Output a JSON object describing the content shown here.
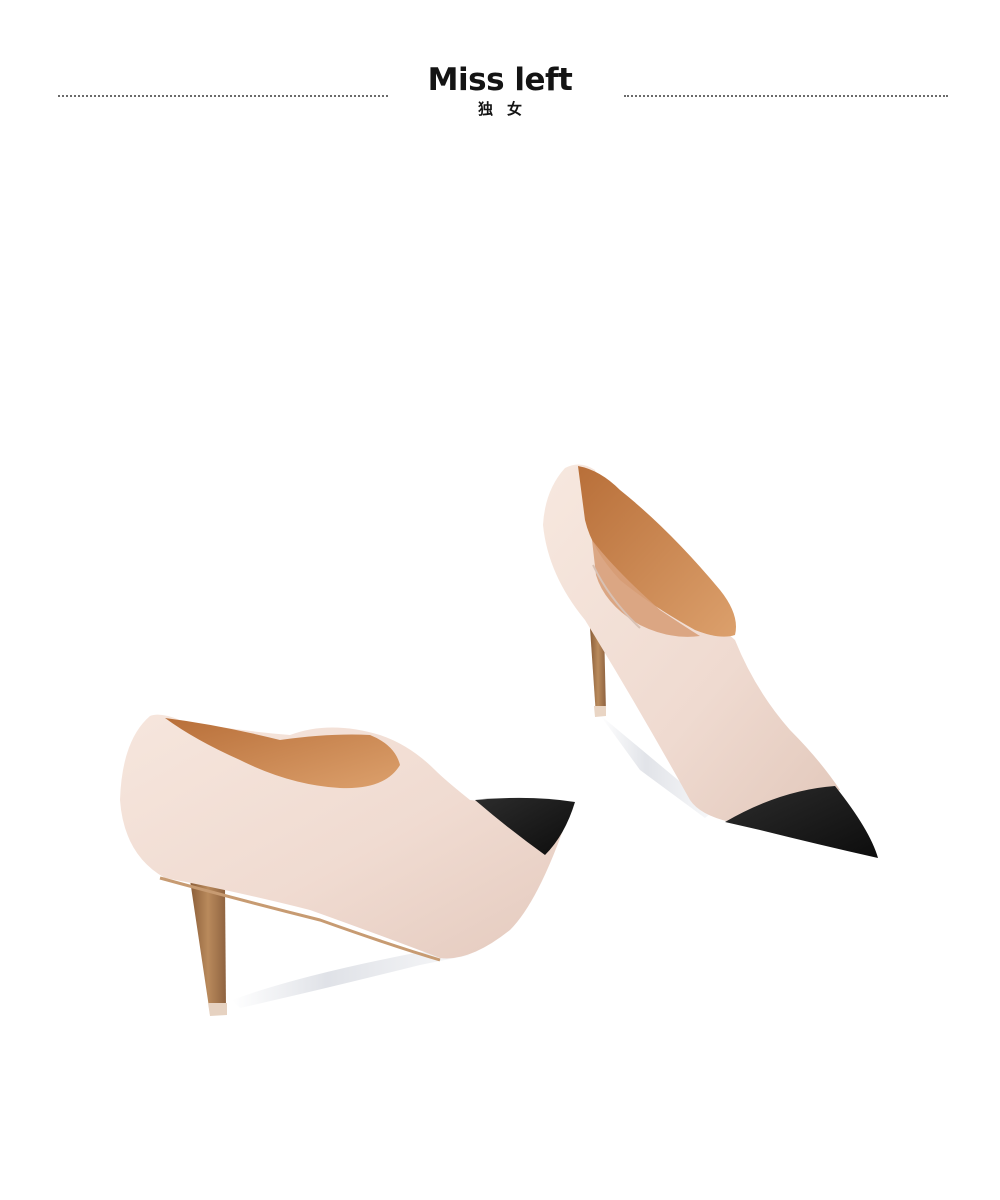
{
  "brand": {
    "name": "Miss left",
    "name_cn": "独女"
  },
  "colors": {
    "leather": "#f1ddd3",
    "toe_cap": "#1a1a1a",
    "lining": "#c9844d",
    "heel": "#a97a4e",
    "background": "#ffffff"
  }
}
